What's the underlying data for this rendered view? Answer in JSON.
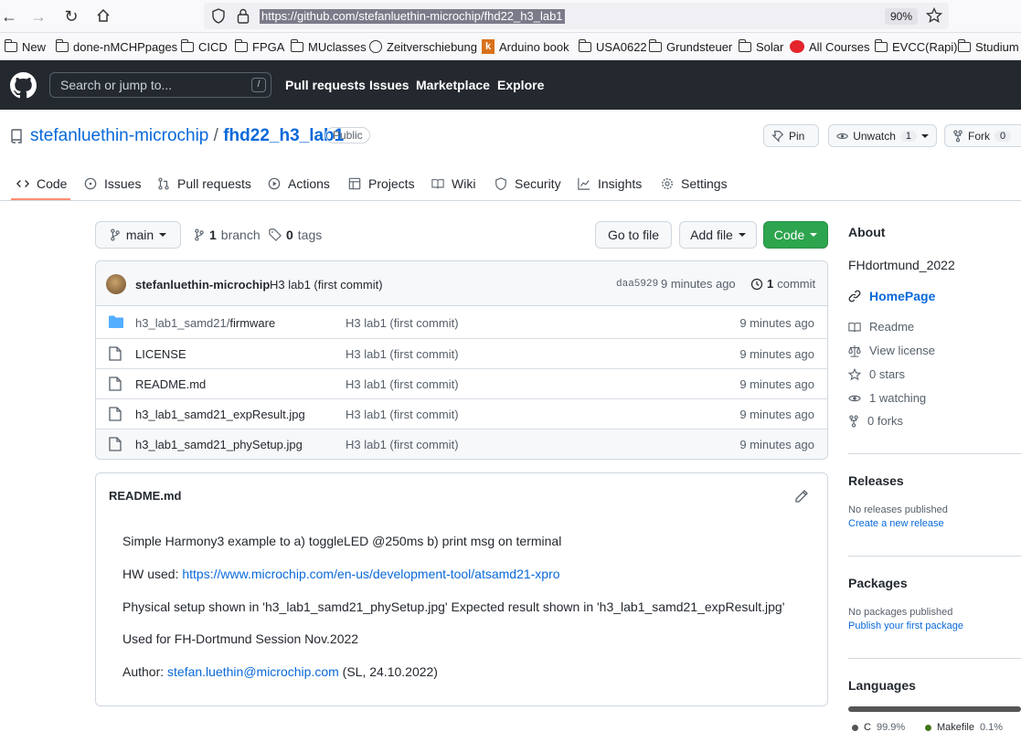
{
  "browser": {
    "url": "https://github.com/stefanluethin-microchip/fhd22_h3_lab1",
    "zoom": "90%",
    "bookmarks": [
      "New",
      "done-nMCHPpages",
      "CICD",
      "FPGA",
      "MUclasses",
      "Zeitverschiebung",
      "Arduino book",
      "USA0622",
      "Grundsteuer",
      "Solar",
      "All Courses",
      "EVCC(Rapi)",
      "Studium"
    ]
  },
  "header": {
    "search_placeholder": "Search or jump to...",
    "slash": "/",
    "nav": [
      "Pull requests",
      "Issues",
      "Marketplace",
      "Explore"
    ]
  },
  "repo": {
    "owner": "stefanluethin-microchip",
    "separator": "/",
    "name": "fhd22_h3_lab1",
    "visibility": "Public",
    "pin": "Pin",
    "unwatch": "Unwatch",
    "watch_count": "1",
    "fork": "Fork",
    "fork_count": "0"
  },
  "tabs": [
    "Code",
    "Issues",
    "Pull requests",
    "Actions",
    "Projects",
    "Wiki",
    "Security",
    "Insights",
    "Settings"
  ],
  "branchbar": {
    "branch": "main",
    "branch_count": "1",
    "branch_label": "branch",
    "tag_count": "0",
    "tag_label": "tags",
    "go_to_file": "Go to file",
    "add_file": "Add file",
    "code": "Code"
  },
  "commit": {
    "author": "stefanluethin-microchip",
    "message": "H3 lab1 (first commit)",
    "hash": "daa5929",
    "age": "9 minutes ago",
    "count": "1",
    "count_label": "commit"
  },
  "files": [
    {
      "dir": "h3_lab1_samd21/",
      "name": "firmware",
      "msg": "H3 lab1 (first commit)",
      "age": "9 minutes ago"
    },
    {
      "name": "LICENSE",
      "msg": "H3 lab1 (first commit)",
      "age": "9 minutes ago"
    },
    {
      "name": "README.md",
      "msg": "H3 lab1 (first commit)",
      "age": "9 minutes ago"
    },
    {
      "name": "h3_lab1_samd21_expResult.jpg",
      "msg": "H3 lab1 (first commit)",
      "age": "9 minutes ago"
    },
    {
      "name": "h3_lab1_samd21_phySetup.jpg",
      "msg": "H3 lab1 (first commit)",
      "age": "9 minutes ago"
    }
  ],
  "readme": {
    "title": "README.md",
    "line1": "Simple Harmony3 example to a) toggleLED @250ms b) print msg on terminal",
    "hw_prefix": "HW used: ",
    "hw_link": "https://www.microchip.com/en-us/development-tool/atsamd21-xpro",
    "line3": "Physical setup shown in 'h3_lab1_samd21_phySetup.jpg' Expected result shown in 'h3_lab1_samd21_expResult.jpg'",
    "line4": "Used for FH-Dortmund Session Nov.2022",
    "author_prefix": "Author: ",
    "author_link": "stefan.luethin@microchip.com",
    "author_suffix": " (SL, 24.10.2022)"
  },
  "about": {
    "title": "About",
    "description": "FHdortmund_2022",
    "homepage": "HomePage",
    "readme": "Readme",
    "license": "View license",
    "stars": "0 stars",
    "watching": "1 watching",
    "forks": "0 forks"
  },
  "releases": {
    "title": "Releases",
    "none": "No releases published",
    "create": "Create a new release"
  },
  "packages": {
    "title": "Packages",
    "none": "No packages published",
    "publish": "Publish your first package"
  },
  "languages": {
    "title": "Languages",
    "items": [
      {
        "name": "C",
        "percent": "99.9%",
        "color": "#555555"
      },
      {
        "name": "Makefile",
        "percent": "0.1%",
        "color": "#427819"
      }
    ]
  },
  "colors": {
    "link": "#0969da",
    "primary_button": "#2da44e",
    "header_bg": "#24292f",
    "tab_underline": "#fd8c73"
  }
}
